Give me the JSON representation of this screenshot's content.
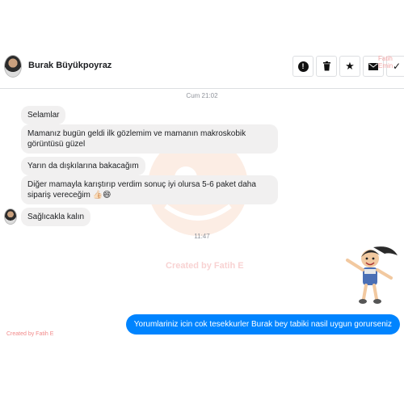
{
  "header": {
    "contact_name": "Burak Büyükpoyraz",
    "toolbar_watermark": "Fatih Emin",
    "buttons": [
      {
        "name": "info",
        "icon": "alert-icon",
        "glyph": "!"
      },
      {
        "name": "delete",
        "icon": "trash-icon",
        "glyph": "🗑"
      },
      {
        "name": "star",
        "icon": "star-icon",
        "glyph": "★"
      },
      {
        "name": "mail",
        "icon": "envelope-icon",
        "glyph": "✉"
      },
      {
        "name": "check",
        "icon": "check-icon",
        "glyph": "✓"
      }
    ]
  },
  "conversation": {
    "timestamp_1": "Cum 21:02",
    "timestamp_2": "11:47",
    "incoming": [
      "Selamlar",
      "Mamanız bugün geldi ilk gözlemim ve mamanın makroskobik görüntüsü güzel",
      "Yarın da dışkılarına bakacağım",
      "Diğer mamayla karıştırıp verdim sonuç iyi olursa 5-6 paket daha sipariş vereceğim 👍🏻😄",
      "Sağlıcakla kalın"
    ],
    "outgoing": "Yorumlariniz icin cok tesekkurler Burak bey tabiki nasil uygun gorurseniz"
  },
  "watermarks": {
    "center": "Created by Fatih E",
    "bottom_left": "Created by Fatih E"
  },
  "colors": {
    "outgoing_bubble": "#0084ff",
    "incoming_bubble": "#f1f0f0"
  }
}
